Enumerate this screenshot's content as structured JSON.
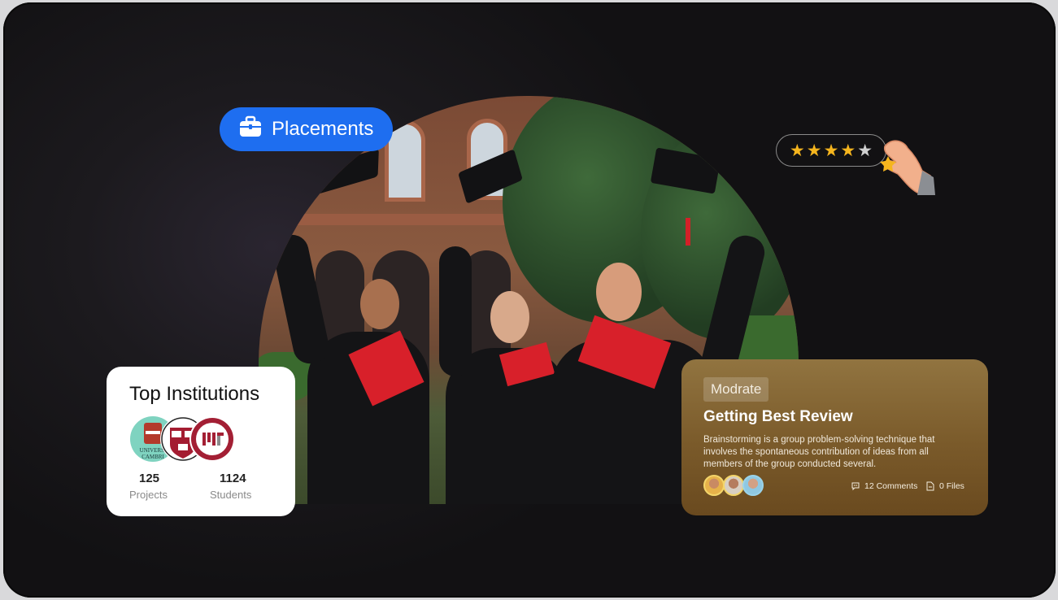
{
  "placements": {
    "label": "Placements",
    "icon": "briefcase-icon"
  },
  "rating": {
    "filled_stars": 4,
    "total_stars": 5,
    "star_color": "#f5b51e"
  },
  "institutions": {
    "title": "Top Institutions",
    "logos": [
      "cambridge-logo",
      "harvard-logo",
      "mit-logo"
    ],
    "stats": [
      {
        "value": "125",
        "label": "Projects"
      },
      {
        "value": "1124",
        "label": "Students"
      }
    ]
  },
  "review": {
    "badge": "Modrate",
    "title": "Getting Best Review",
    "description": "Brainstorming is a group problem-solving technique that involves the spontaneous contribution of ideas from all members of the group conducted several.",
    "comments": "12 Comments",
    "files": "0 Files"
  },
  "colors": {
    "accent": "#1e6ef0",
    "background": "#161517",
    "card_gold": "#7a5a2a"
  }
}
